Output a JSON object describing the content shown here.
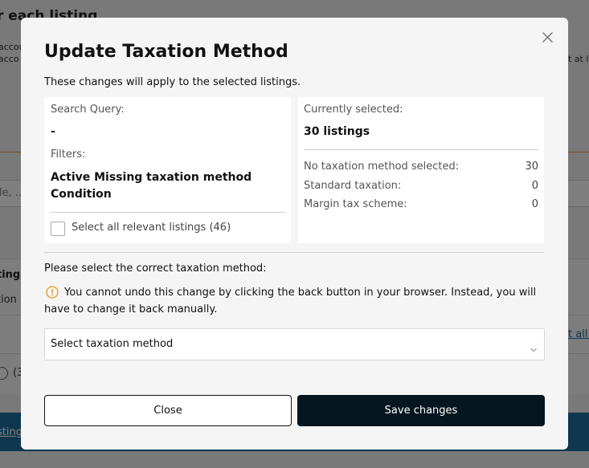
{
  "background": {
    "heading": "r each listing",
    "text_line_1": "accou",
    "text_line_2": "acco",
    "text_line_right": "t at le",
    "search_placeholder": "le, ...",
    "row_label_1": "ting",
    "row_label_2": "tion",
    "row_link": "t all f",
    "row_count": "(3",
    "bottom_link": "sting"
  },
  "modal": {
    "title": "Update Taxation Method",
    "subtitle": "These changes will apply to the selected listings.",
    "left_panel": {
      "search_query_label": "Search Query:",
      "search_query_value": "-",
      "filters_label": "Filters:",
      "filters_value": "Active Missing taxation method Condition",
      "select_all_label": "Select all relevant listings (46)",
      "select_all_checked": false
    },
    "right_panel": {
      "currently_selected_label": "Currently selected:",
      "currently_selected_value": "30 listings",
      "rows": [
        {
          "label": "No taxation method selected:",
          "count": "30"
        },
        {
          "label": "Standard taxation:",
          "count": "0"
        },
        {
          "label": "Margin tax scheme:",
          "count": "0"
        }
      ]
    },
    "prompt": "Please select the correct taxation method:",
    "warning": "You cannot undo this change by clicking the back button in your browser. Instead, you will have to change it back manually.",
    "select_placeholder": "Select taxation method",
    "close_label": "Close",
    "save_label": "Save changes"
  },
  "colors": {
    "warning_icon": "#e39a1c",
    "save_button_bg": "#06161f",
    "bottom_bar": "#1d6e9c"
  }
}
